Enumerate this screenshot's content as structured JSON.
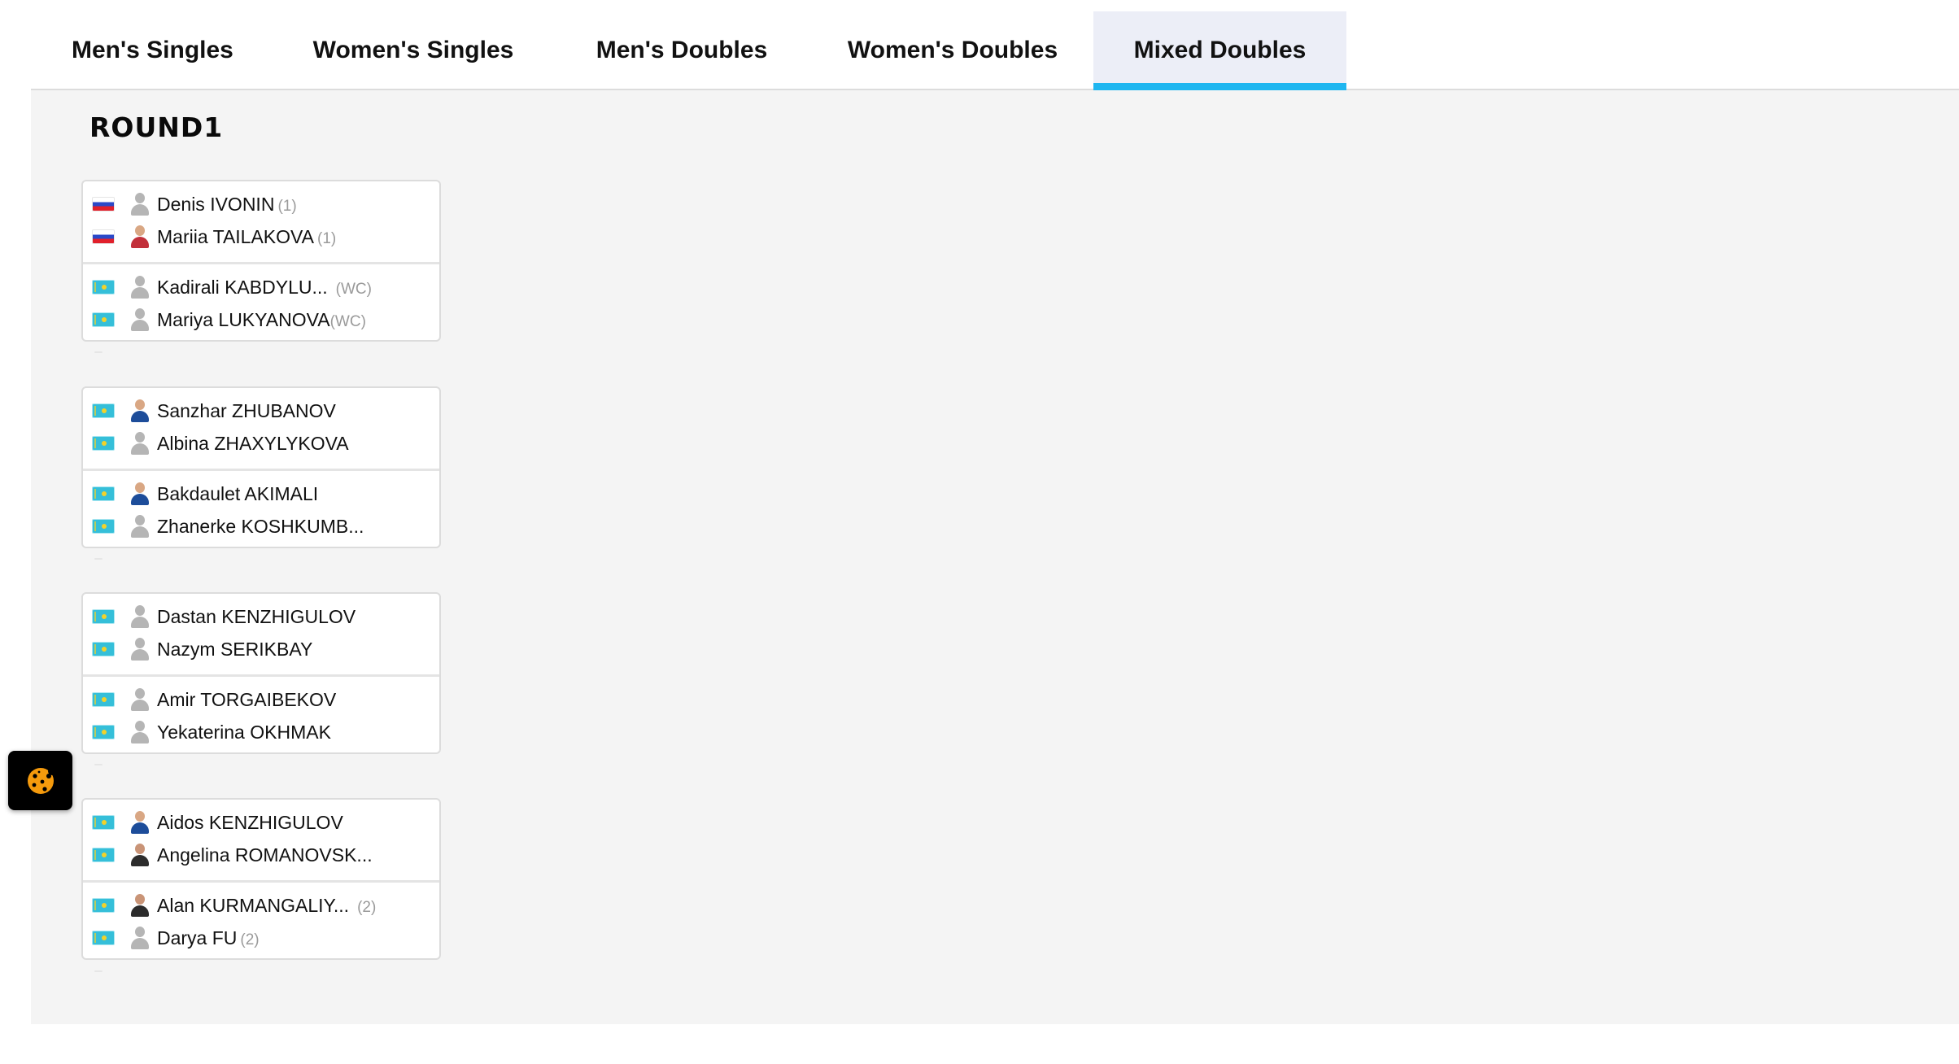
{
  "tabs": [
    {
      "label": "Men's Singles",
      "active": false
    },
    {
      "label": "Women's Singles",
      "active": false
    },
    {
      "label": "Men's Doubles",
      "active": false
    },
    {
      "label": "Women's Doubles",
      "active": false
    },
    {
      "label": "Mixed Doubles",
      "active": true
    }
  ],
  "colors": {
    "active_tab_underline": "#1fb6f0",
    "active_tab_bg": "#eceef7",
    "panel_bg": "#f4f4f4"
  },
  "round": {
    "title": "ROUND1"
  },
  "matches": [
    {
      "teams": [
        {
          "players": [
            {
              "flag": "russia-flag",
              "avatar": "placeholder",
              "name": "Denis IVONIN",
              "seed": "(1)"
            },
            {
              "flag": "russia-flag",
              "avatar": "photo",
              "name": "Mariia TAILAKOVA",
              "seed": "(1)"
            }
          ]
        },
        {
          "players": [
            {
              "flag": "kazakhstan-flag",
              "avatar": "placeholder",
              "name": "Kadirali KABDYLU...",
              "seed": "(WC)"
            },
            {
              "flag": "kazakhstan-flag",
              "avatar": "placeholder",
              "name": "Mariya LUKYANOVA",
              "seed": "(WC)"
            }
          ]
        }
      ]
    },
    {
      "teams": [
        {
          "players": [
            {
              "flag": "kazakhstan-flag",
              "avatar": "photo",
              "name": "Sanzhar ZHUBANOV",
              "seed": ""
            },
            {
              "flag": "kazakhstan-flag",
              "avatar": "placeholder",
              "name": "Albina ZHAXYLYKOVA",
              "seed": ""
            }
          ]
        },
        {
          "players": [
            {
              "flag": "kazakhstan-flag",
              "avatar": "photo",
              "name": "Bakdaulet AKIMALI",
              "seed": ""
            },
            {
              "flag": "kazakhstan-flag",
              "avatar": "placeholder",
              "name": "Zhanerke KOSHKUMB...",
              "seed": ""
            }
          ]
        }
      ]
    },
    {
      "teams": [
        {
          "players": [
            {
              "flag": "kazakhstan-flag",
              "avatar": "placeholder",
              "name": "Dastan KENZHIGULOV",
              "seed": ""
            },
            {
              "flag": "kazakhstan-flag",
              "avatar": "placeholder",
              "name": "Nazym SERIKBAY",
              "seed": ""
            }
          ]
        },
        {
          "players": [
            {
              "flag": "kazakhstan-flag",
              "avatar": "placeholder",
              "name": "Amir TORGAIBEKOV",
              "seed": ""
            },
            {
              "flag": "kazakhstan-flag",
              "avatar": "placeholder",
              "name": "Yekaterina OKHMAK",
              "seed": ""
            }
          ]
        }
      ]
    },
    {
      "teams": [
        {
          "players": [
            {
              "flag": "kazakhstan-flag",
              "avatar": "photo",
              "name": "Aidos KENZHIGULOV",
              "seed": ""
            },
            {
              "flag": "kazakhstan-flag",
              "avatar": "photo",
              "name": "Angelina ROMANOVSK...",
              "seed": ""
            }
          ]
        },
        {
          "players": [
            {
              "flag": "kazakhstan-flag",
              "avatar": "photo",
              "name": "Alan KURMANGALIY...",
              "seed": "(2)"
            },
            {
              "flag": "kazakhstan-flag",
              "avatar": "placeholder",
              "name": "Darya FU",
              "seed": "(2)"
            }
          ]
        }
      ]
    }
  ],
  "cookie_button": {
    "icon": "cookie-icon"
  }
}
